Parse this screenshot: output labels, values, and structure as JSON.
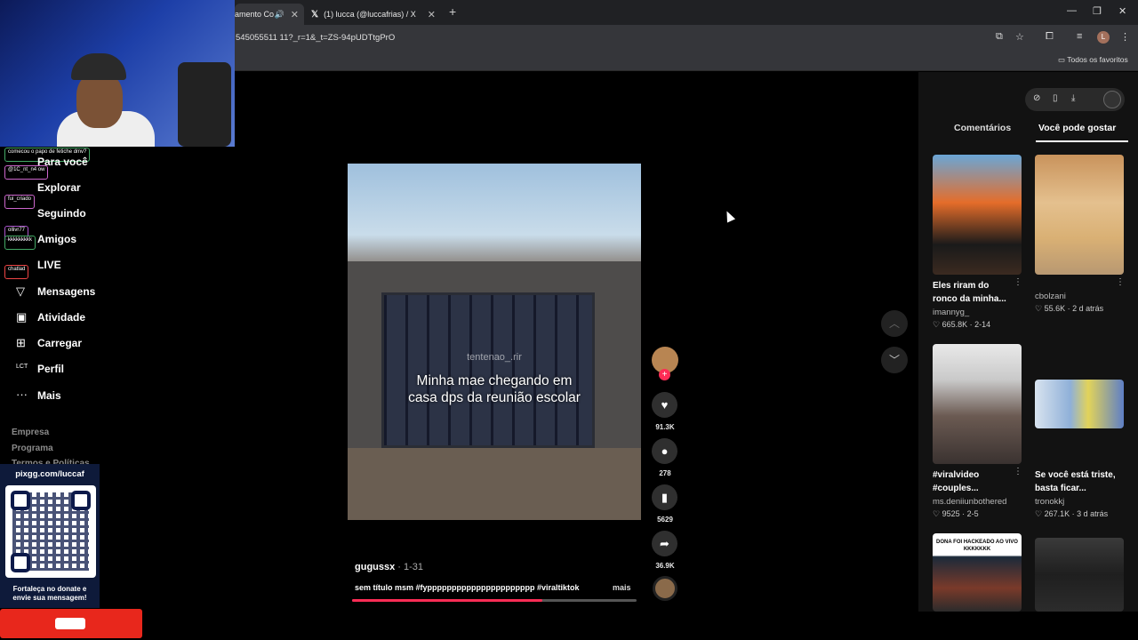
{
  "browser": {
    "tabs": [
      {
        "title": "amento Co",
        "active": true
      },
      {
        "title": "(1) lucca (@luccafrias) / X",
        "active": false
      }
    ],
    "url": "545055511 11?_r=1&_t=ZS-94pUDTtgPrO",
    "bookmarks_label": "Todos os favoritos",
    "profile_initial": "L"
  },
  "chat_overlay": [
    "comecou o papo de fetiche dmv?",
    "@1C_nt_n4 ow",
    "fui_criado",
    "ollivr77",
    "kkkkkkkkk",
    "chatlad"
  ],
  "sidebar": {
    "items": [
      {
        "label": "Para você",
        "icon": "home-icon"
      },
      {
        "label": "Explorar",
        "icon": "compass-icon"
      },
      {
        "label": "Seguindo",
        "icon": "following-icon"
      },
      {
        "label": "Amigos",
        "icon": "friends-icon"
      },
      {
        "label": "LIVE",
        "icon": "live-icon"
      },
      {
        "label": "Mensagens",
        "icon": "messages-icon"
      },
      {
        "label": "Atividade",
        "icon": "activity-icon"
      },
      {
        "label": "Carregar",
        "icon": "upload-icon"
      },
      {
        "label": "Perfil",
        "icon": "profile-icon"
      },
      {
        "label": "Mais",
        "icon": "more-icon"
      }
    ],
    "footer": [
      "Empresa",
      "Programa",
      "Termos e Políticas"
    ]
  },
  "pix": {
    "title": "pixgg.com/luccaf",
    "note_line1": "Fortaleça no donate e",
    "note_line2": "envie sua mensagem!"
  },
  "video": {
    "watermark": "tentenao_.rir",
    "caption_line1": "Minha mae chegando em",
    "caption_line2": "casa dps da reunião escolar",
    "author": "gugussx",
    "date": " · 1-31",
    "description": "sem título msm #fypppppppppppppppppppppp #viraltiktok",
    "more_label": "mais",
    "progress": 0.67
  },
  "actions": {
    "likes": "91.3K",
    "comments": "278",
    "saves": "5629",
    "shares": "36.9K"
  },
  "right_panel": {
    "tabs": [
      "Comentários",
      "Você pode gostar"
    ],
    "active_tab": 1,
    "cards": [
      {
        "title": "Eles riram do ronco da minha...",
        "user": "imannyg_",
        "likes": "665.8K",
        "date": "2-14"
      },
      {
        "title": "",
        "user": "cbolzani",
        "likes": "55.6K",
        "date": "2 d atrás"
      },
      {
        "title": "#viralvideo #couples...",
        "user": "ms.deniiunbothered",
        "likes": "9525",
        "date": "2-5"
      },
      {
        "title": "Se você está triste, basta ficar...",
        "user": "tronokkj",
        "likes": "267.1K",
        "date": "3 d atrás"
      }
    ],
    "bottom_card_text": "DONA FOI HACKEADO AO VIVO KKKKKKK"
  },
  "colors": {
    "accent": "#fe2c55",
    "donate": "#e8271c",
    "panel": "#121212"
  }
}
